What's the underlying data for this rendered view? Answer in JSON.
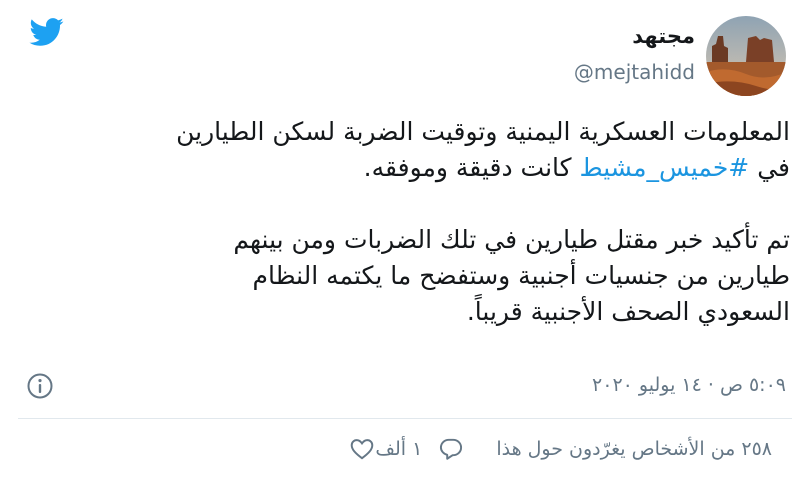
{
  "author": {
    "name": "مجتهد",
    "handle": "@mejtahidd"
  },
  "tweet": {
    "line1": "المعلومات العسكرية اليمنية وتوقيت الضربة لسكن الطيارين",
    "line2_before": "في ",
    "hashtag": "#خميس_مشيط",
    "line2_after": " كانت دقيقة وموفقه.",
    "line3": "تم تأكيد خبر مقتل طيارين في تلك الضربات ومن بينهم",
    "line4": "طيارين من جنسيات أجنبية وستفضح ما يكتمه النظام",
    "line5": "السعودي الصحف الأجنبية قريباً."
  },
  "timestamp": "٥:٠٩ ص · ١٤ يوليو ٢٠٢٠",
  "actions": {
    "likes": "١ ألف",
    "replies": "٢٥٨ من الأشخاص يغرّدون حول هذا"
  },
  "colors": {
    "brand": "#1da1f2",
    "link": "#1b95e0",
    "secondary_text": "#657786"
  },
  "icons": [
    "twitter-bird-icon",
    "info-icon",
    "heart-icon",
    "reply-icon"
  ]
}
